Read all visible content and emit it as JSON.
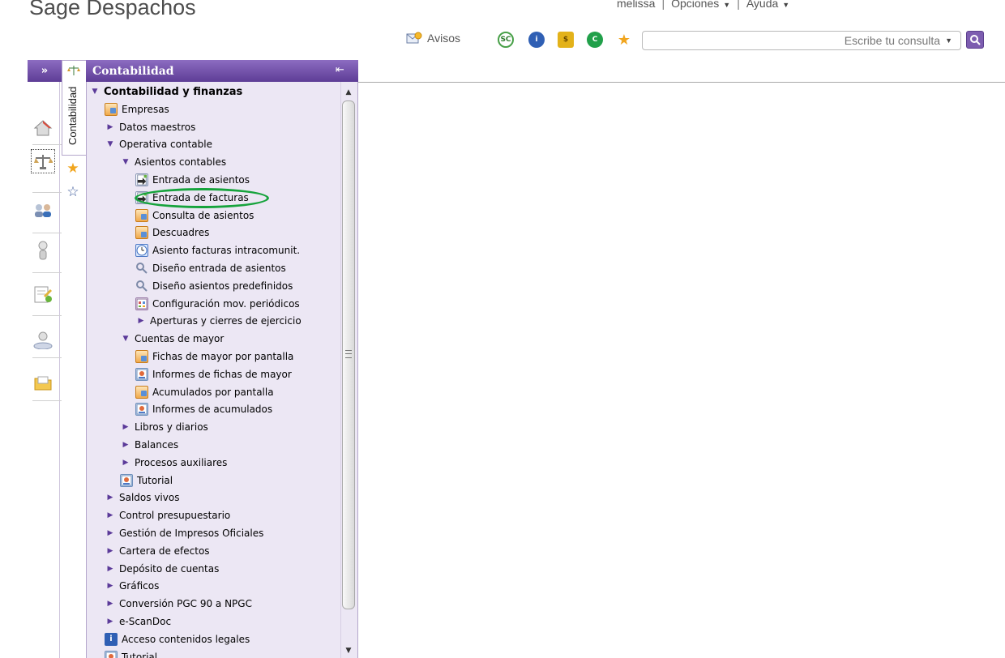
{
  "header": {
    "app_title": "Sage Despachos",
    "user": "melissa",
    "options_label": "Opciones",
    "help_label": "Ayuda",
    "avisos_label": "Avisos",
    "search_placeholder": "Escribe tu consulta",
    "toolbar_icons": [
      "sc-icon",
      "info-icon",
      "coins-icon",
      "c-icon",
      "favorites-star-icon"
    ]
  },
  "rail": {
    "expand_label": "»",
    "items": [
      "home-icon",
      "accounting-scale-icon",
      "users-icon",
      "person-icon",
      "documents-icon",
      "user-group-icon",
      "folder-icon"
    ]
  },
  "vertical_tab": {
    "label": "Contabilidad"
  },
  "panel": {
    "title": "Contabilidad",
    "pin_label": "⇤"
  },
  "tree": [
    {
      "label": "Contabilidad y finanzas",
      "level": 0,
      "toggle": "expanded",
      "icon": "",
      "bold": true
    },
    {
      "label": "Empresas",
      "level": 1,
      "toggle": "",
      "icon": "doc"
    },
    {
      "label": "Datos maestros",
      "level": 1,
      "toggle": "collapsed",
      "icon": ""
    },
    {
      "label": "Operativa contable",
      "level": 1,
      "toggle": "expanded",
      "icon": ""
    },
    {
      "label": "Asientos contables",
      "level": 2,
      "toggle": "expanded",
      "icon": ""
    },
    {
      "label": "Entrada de asientos",
      "level": 3,
      "toggle": "",
      "icon": "arrow"
    },
    {
      "label": "Entrada de facturas",
      "level": 3,
      "toggle": "",
      "icon": "arrow"
    },
    {
      "label": "Consulta de asientos",
      "level": 3,
      "toggle": "",
      "icon": "doc"
    },
    {
      "label": "Descuadres",
      "level": 3,
      "toggle": "",
      "icon": "doc"
    },
    {
      "label": "Asiento facturas intracomunit.",
      "level": 3,
      "toggle": "",
      "icon": "clock"
    },
    {
      "label": "Diseño entrada de asientos",
      "level": 3,
      "toggle": "",
      "icon": "wrench"
    },
    {
      "label": "Diseño asientos predefinidos",
      "level": 3,
      "toggle": "",
      "icon": "wrench"
    },
    {
      "label": "Configuración mov. periódicos",
      "level": 3,
      "toggle": "",
      "icon": "grid"
    },
    {
      "label": "Aperturas y cierres de ejercicio",
      "level": 3,
      "toggle": "collapsed",
      "icon": ""
    },
    {
      "label": "Cuentas de mayor",
      "level": 2,
      "toggle": "expanded",
      "icon": ""
    },
    {
      "label": "Fichas de mayor por pantalla",
      "level": 3,
      "toggle": "",
      "icon": "doc"
    },
    {
      "label": "Informes de fichas de mayor",
      "level": 3,
      "toggle": "",
      "icon": "report"
    },
    {
      "label": "Acumulados por pantalla",
      "level": 3,
      "toggle": "",
      "icon": "doc"
    },
    {
      "label": "Informes de acumulados",
      "level": 3,
      "toggle": "",
      "icon": "report"
    },
    {
      "label": "Libros y diarios",
      "level": 2,
      "toggle": "collapsed",
      "icon": ""
    },
    {
      "label": "Balances",
      "level": 2,
      "toggle": "collapsed",
      "icon": ""
    },
    {
      "label": "Procesos auxiliares",
      "level": 2,
      "toggle": "collapsed",
      "icon": ""
    },
    {
      "label": "Tutorial",
      "level": 2,
      "toggle": "",
      "icon": "report"
    },
    {
      "label": "Saldos vivos",
      "level": 1,
      "toggle": "collapsed",
      "icon": ""
    },
    {
      "label": "Control presupuestario",
      "level": 1,
      "toggle": "collapsed",
      "icon": ""
    },
    {
      "label": "Gestión de Impresos Oficiales",
      "level": 1,
      "toggle": "collapsed",
      "icon": ""
    },
    {
      "label": "Cartera de efectos",
      "level": 1,
      "toggle": "collapsed",
      "icon": ""
    },
    {
      "label": "Depósito de cuentas",
      "level": 1,
      "toggle": "collapsed",
      "icon": ""
    },
    {
      "label": "Gráficos",
      "level": 1,
      "toggle": "collapsed",
      "icon": ""
    },
    {
      "label": "Conversión PGC 90 a NPGC",
      "level": 1,
      "toggle": "collapsed",
      "icon": ""
    },
    {
      "label": "e-ScanDoc",
      "level": 1,
      "toggle": "collapsed",
      "icon": ""
    },
    {
      "label": "Acceso contenidos legales",
      "level": 1,
      "toggle": "",
      "icon": "blue"
    },
    {
      "label": "Tutorial",
      "level": 1,
      "toggle": "",
      "icon": "report"
    }
  ],
  "highlighted_item": "Entrada de facturas",
  "colors": {
    "brand_purple": "#6b49a8",
    "panel_bg": "#ece7f4",
    "highlight_green": "#16a33c"
  }
}
